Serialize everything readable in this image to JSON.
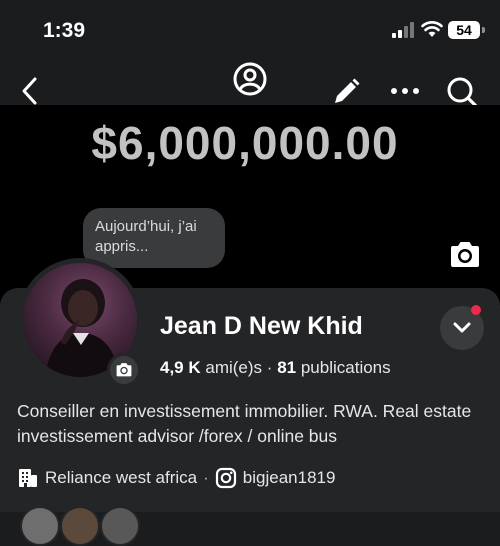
{
  "status": {
    "time": "1:39",
    "battery": "54"
  },
  "cover": {
    "amount": "$6,000,000.00"
  },
  "note": {
    "text": "Aujourd’hui, j’ai appris..."
  },
  "profile": {
    "name": "Jean D New Khid",
    "friends_count": "4,9 K",
    "friends_label": "ami(e)s",
    "dot": "·",
    "posts_count": "81",
    "posts_label": "publications",
    "bio": "Conseiller en investissement immobilier. RWA. Real estate investissement advisor /forex / online bus",
    "workplace": "Reliance west africa",
    "separator": "·",
    "instagram": "bigjean1819"
  },
  "colors": {
    "background": "#000000",
    "card": "#242527",
    "notification_dot": "#f0284a"
  },
  "icons": [
    "back-icon",
    "profile-icon",
    "pencil-icon",
    "more-icon",
    "search-icon",
    "camera-icon",
    "chevron-down-icon",
    "building-icon",
    "instagram-icon"
  ]
}
